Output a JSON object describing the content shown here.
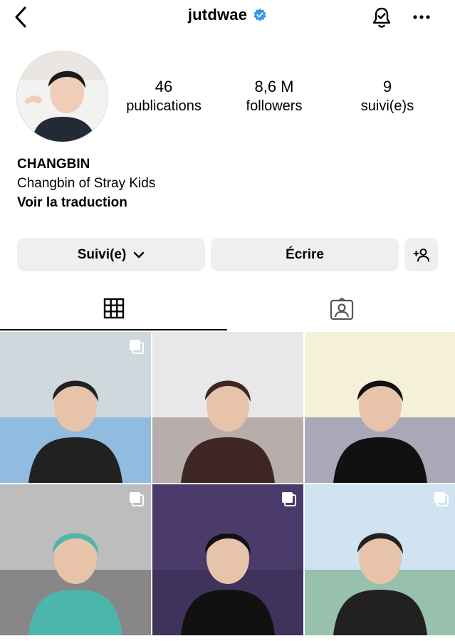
{
  "header": {
    "username": "jutdwae",
    "icons": {
      "back": "chevron-left-icon",
      "verified": "verified-badge-icon",
      "notifications": "bell-check-icon",
      "more": "more-horizontal-icon"
    }
  },
  "profile": {
    "stats": [
      {
        "value": "46",
        "label": "publications"
      },
      {
        "value": "8,6 M",
        "label": "followers"
      },
      {
        "value": "9",
        "label": "suivi(e)s"
      }
    ],
    "name": "CHANGBIN",
    "bio": "Changbin of Stray Kids",
    "translate_link": "Voir la traduction"
  },
  "actions": {
    "follow_label": "Suivi(e)",
    "message_label": "Écrire",
    "suggest_icon": "add-person-icon"
  },
  "tabs": [
    {
      "name": "posts-grid",
      "icon": "grid-icon",
      "active": true
    },
    {
      "name": "tagged",
      "icon": "tagged-person-icon",
      "active": false
    }
  ],
  "posts": [
    {
      "multi": true,
      "palette": [
        "#cfd8dc",
        "#1e88e5",
        "#212121"
      ]
    },
    {
      "multi": false,
      "palette": [
        "#e8e8e8",
        "#5d4037",
        "#3e2723"
      ]
    },
    {
      "multi": false,
      "palette": [
        "#f5f0d8",
        "#1a237e",
        "#111111"
      ]
    },
    {
      "multi": true,
      "palette": [
        "#bdbdbd",
        "#212121",
        "#4db6ac"
      ]
    },
    {
      "multi": true,
      "palette": [
        "#4a3b6b",
        "#2b2540",
        "#111111"
      ]
    },
    {
      "multi": true,
      "palette": [
        "#cfe3f0",
        "#2e7d32",
        "#212121"
      ]
    }
  ],
  "colors": {
    "accent_blue": "#3897f0",
    "button_bg": "#efefef",
    "border": "#dbdbdb"
  }
}
